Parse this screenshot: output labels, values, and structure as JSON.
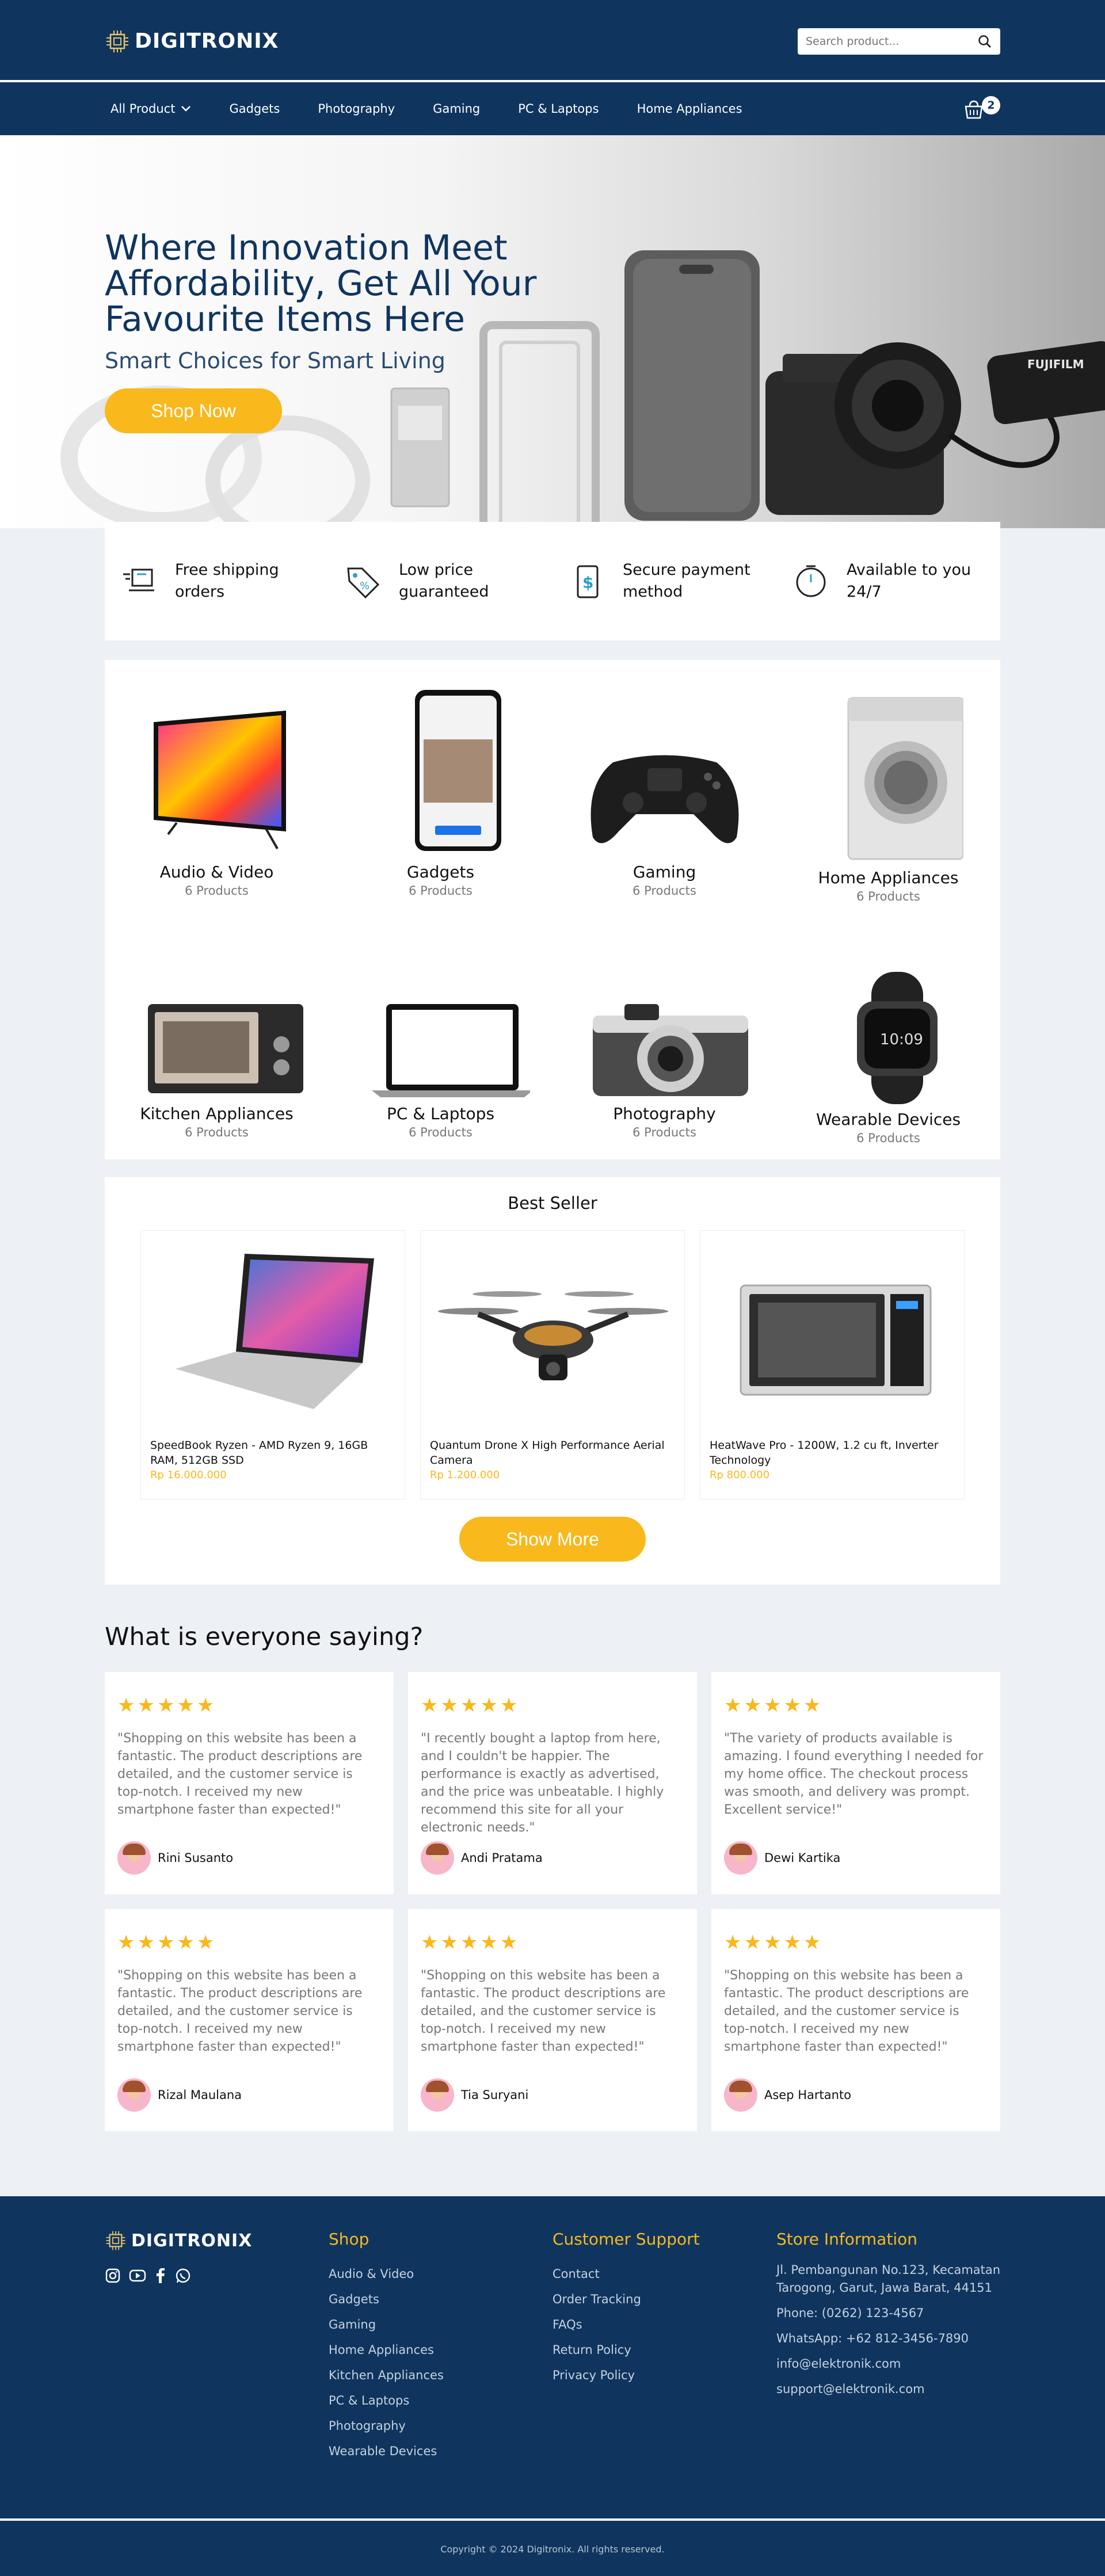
{
  "header": {
    "brand": "DIGITRONIX",
    "search_placeholder": "Search product...",
    "nav": [
      "All Product",
      "Gadgets",
      "Photography",
      "Gaming",
      "PC & Laptops",
      "Home Appliances"
    ],
    "cart_count": "2"
  },
  "hero": {
    "title": "Where Innovation Meet Affordability, Get All Your Favourite Items Here",
    "subtitle": "Smart Choices for Smart Living",
    "cta": "Shop Now"
  },
  "features": [
    {
      "icon": "delivery-icon",
      "text": "Free shipping orders"
    },
    {
      "icon": "price-tag-icon",
      "text": "Low price guaranteed"
    },
    {
      "icon": "payment-icon",
      "text": "Secure payment method"
    },
    {
      "icon": "clock-icon",
      "text": "Available to you 24/7"
    }
  ],
  "categories": [
    {
      "name": "Audio & Video",
      "count": "6 Products"
    },
    {
      "name": "Gadgets",
      "count": "6 Products"
    },
    {
      "name": "Gaming",
      "count": "6 Products"
    },
    {
      "name": "Home Appliances",
      "count": "6 Products"
    },
    {
      "name": "Kitchen Appliances",
      "count": "6 Products"
    },
    {
      "name": "PC & Laptops",
      "count": "6 Products"
    },
    {
      "name": "Photography",
      "count": "6 Products"
    },
    {
      "name": "Wearable Devices",
      "count": "6 Products"
    }
  ],
  "best_seller": {
    "title": "Best Seller",
    "products": [
      {
        "name": "SpeedBook Ryzen - AMD Ryzen 9, 16GB RAM, 512GB SSD",
        "price": "Rp 16.000.000"
      },
      {
        "name": "Quantum Drone X High Performance Aerial Camera",
        "price": "Rp 1.200.000"
      },
      {
        "name": "HeatWave Pro - 1200W, 1.2 cu ft, Inverter Technology",
        "price": "Rp 800.000"
      }
    ],
    "more": "Show More"
  },
  "testimonials": {
    "title": "What is everyone saying?",
    "items": [
      {
        "stars": "★★★★★",
        "quote": "\"Shopping on this website has been a fantastic. The product descriptions are detailed, and the customer service is top-notch. I received my new smartphone faster than expected!\"",
        "name": "Rini Susanto"
      },
      {
        "stars": "★★★★★",
        "quote": "\"I recently bought a laptop from here, and I couldn't be happier. The performance is exactly as advertised, and the price was unbeatable. I highly recommend this site for all your electronic needs.\"",
        "name": "Andi Pratama"
      },
      {
        "stars": "★★★★★",
        "quote": "\"The variety of products available is amazing. I found everything I needed for my home office. The checkout process was smooth, and delivery was prompt. Excellent service!\"",
        "name": "Dewi Kartika"
      },
      {
        "stars": "★★★★★",
        "quote": "\"Shopping on this website has been a fantastic. The product descriptions are detailed, and the customer service is top-notch. I received my new smartphone faster than expected!\"",
        "name": "Rizal Maulana"
      },
      {
        "stars": "★★★★★",
        "quote": "\"Shopping on this website has been a fantastic. The product descriptions are detailed, and the customer service is top-notch. I received my new smartphone faster than expected!\"",
        "name": "Tia Suryani"
      },
      {
        "stars": "★★★★★",
        "quote": "\"Shopping on this website has been a fantastic. The product descriptions are detailed, and the customer service is top-notch. I received my new smartphone faster than expected!\"",
        "name": "Asep Hartanto"
      }
    ]
  },
  "footer": {
    "brand": "DIGITRONIX",
    "social_icons": [
      "instagram-icon",
      "youtube-icon",
      "facebook-icon",
      "whatsapp-icon"
    ],
    "shop_title": "Shop",
    "shop_links": [
      "Audio & Video",
      "Gadgets",
      "Gaming",
      "Home Appliances",
      "Kitchen Appliances",
      "PC & Laptops",
      "Photography",
      "Wearable Devices"
    ],
    "support_title": "Customer Support",
    "support_links": [
      "Contact",
      "Order Tracking",
      "FAQs",
      "Return Policy",
      "Privacy Policy"
    ],
    "store_title": "Store Information",
    "store_info": [
      "Jl. Pembangunan No.123, Kecamatan Tarogong, Garut, Jawa Barat, 44151",
      "Phone: (0262) 123-4567",
      "WhatsApp: +62 812-3456-7890",
      "info@elektronik.com",
      "support@elektronik.com"
    ],
    "copyright": "Copyright © 2024 Digitronix. All rights reserved."
  },
  "colors": {
    "primary": "#0f355f",
    "accent": "#f9b81b",
    "background": "#edf1f5"
  }
}
